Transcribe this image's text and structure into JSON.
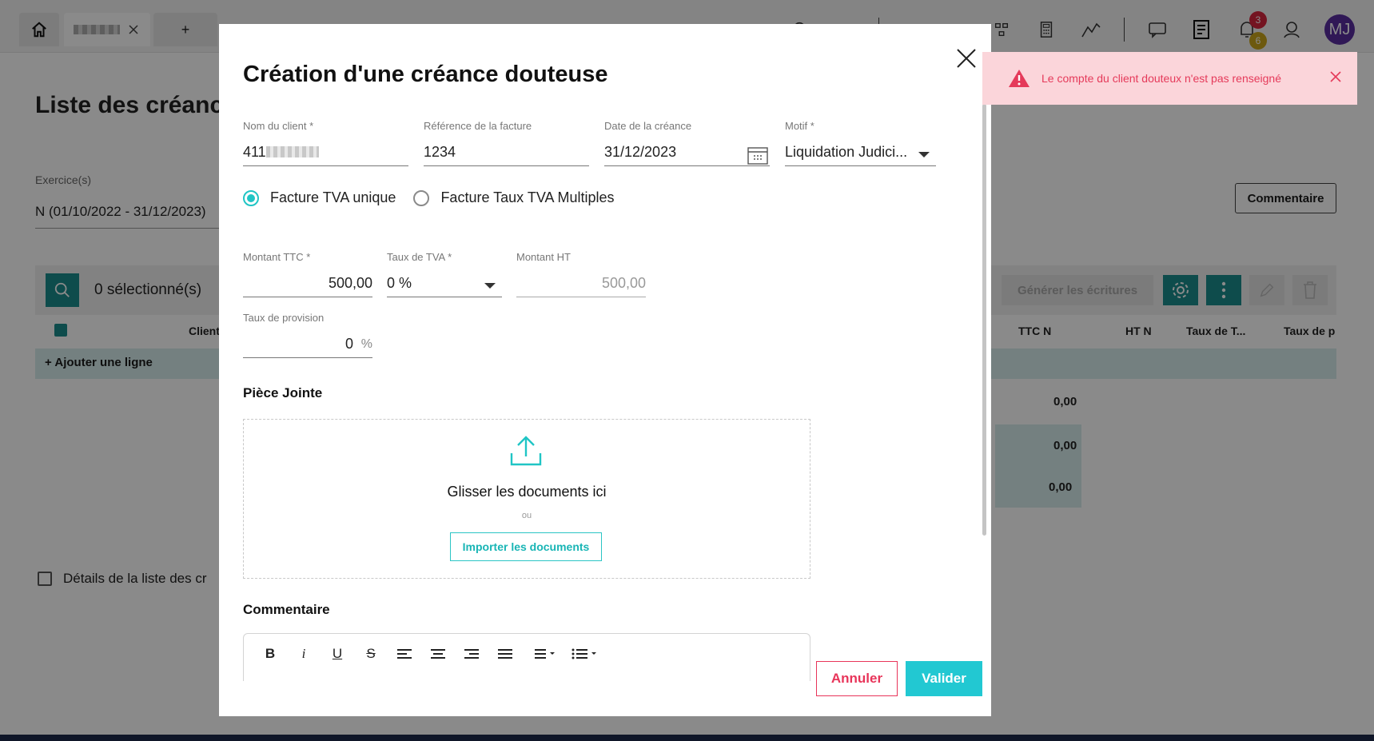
{
  "tabs": {
    "add_label": "+"
  },
  "header": {
    "notifications_red": "3",
    "notifications_yellow": "6",
    "avatar_initials": "MJ"
  },
  "background": {
    "page_title": "Liste des créanc",
    "exercise_label": "Exercice(s)",
    "exercise_value": "N (01/10/2022 - 31/12/2023)",
    "comment_button": "Commentaire",
    "selected_count": "0 sélectionné(s)",
    "generate_button": "Générer les écritures",
    "columns": {
      "client": "Client",
      "ttc": "TTC N",
      "ht": "HT N",
      "taux_t": "Taux de T...",
      "taux_p": "Taux de p"
    },
    "add_line": "+ Ajouter une ligne",
    "values": [
      "0,00",
      "0,00",
      "0,00"
    ],
    "details_label": "Détails de la liste des cr"
  },
  "modal": {
    "title": "Création d'une créance douteuse",
    "fields": {
      "client_name": {
        "label": "Nom du client *",
        "value": "411"
      },
      "invoice_ref": {
        "label": "Référence de la facture",
        "value": "1234"
      },
      "claim_date": {
        "label": "Date de la créance",
        "value": "31/12/2023"
      },
      "reason": {
        "label": "Motif *",
        "value": "Liquidation Judici..."
      },
      "amount_ttc": {
        "label": "Montant TTC *",
        "value": "500,00"
      },
      "vat_rate": {
        "label": "Taux de TVA *",
        "value": "0 %"
      },
      "amount_ht": {
        "label": "Montant HT",
        "value": "500,00"
      },
      "provision_rate": {
        "label": "Taux de provision",
        "value": "0",
        "unit": "%"
      }
    },
    "radios": {
      "single": "Facture TVA unique",
      "multiple": "Facture Taux TVA Multiples"
    },
    "attachment": {
      "title": "Pièce Jointe",
      "drop_text": "Glisser les documents ici",
      "or_text": "ou",
      "import_button": "Importer les documents"
    },
    "comment_title": "Commentaire",
    "editor_tools": {
      "bold": "B",
      "italic": "i",
      "underline": "U",
      "strike": "S"
    },
    "cancel_button": "Annuler",
    "validate_button": "Valider"
  },
  "toast": {
    "message": "Le compte du client douteux n'est pas renseigné"
  },
  "colors": {
    "accent": "#20c5c5",
    "danger": "#e53a5a",
    "toast_bg": "#fbd5da",
    "avatar": "#5a2da0"
  }
}
